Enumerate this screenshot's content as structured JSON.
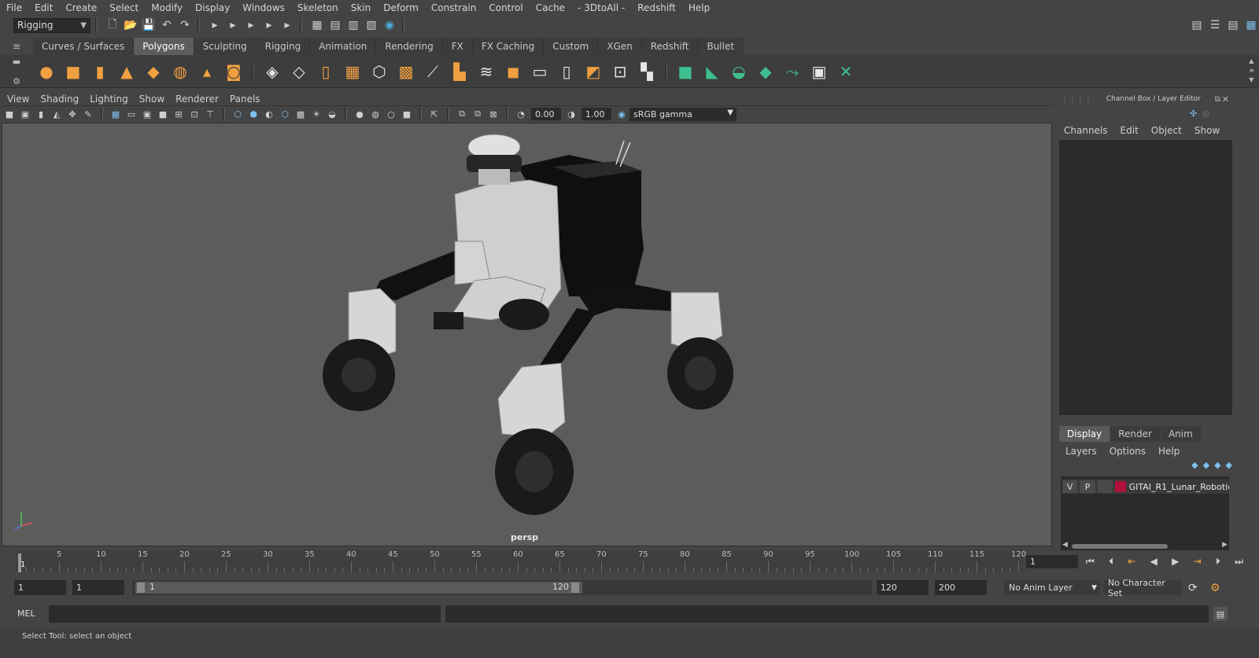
{
  "menubar": [
    "File",
    "Edit",
    "Create",
    "Select",
    "Modify",
    "Display",
    "Windows",
    "Skeleton",
    "Skin",
    "Deform",
    "Constrain",
    "Control",
    "Cache",
    "- 3DtoAll -",
    "Redshift",
    "Help"
  ],
  "statusline": {
    "mode": "Rigging"
  },
  "shelf_tabs": [
    "Curves / Surfaces",
    "Polygons",
    "Sculpting",
    "Rigging",
    "Animation",
    "Rendering",
    "FX",
    "FX Caching",
    "Custom",
    "XGen",
    "Redshift",
    "Bullet"
  ],
  "active_shelf_tab": "Polygons",
  "viewport": {
    "menu": [
      "View",
      "Shading",
      "Lighting",
      "Show",
      "Renderer",
      "Panels"
    ],
    "exposure": "0.00",
    "gamma_value": "1.00",
    "color_space": "sRGB gamma",
    "camera": "persp"
  },
  "channel_box": {
    "title": "Channel Box / Layer Editor",
    "menu": [
      "Channels",
      "Edit",
      "Object",
      "Show"
    ]
  },
  "layer_editor": {
    "tabs": [
      "Display",
      "Render",
      "Anim"
    ],
    "active_tab": "Display",
    "menu": [
      "Layers",
      "Options",
      "Help"
    ],
    "layers": [
      {
        "v": "V",
        "p": "P",
        "color": "#b0103a",
        "name": "GITAI_R1_Lunar_Robotic"
      }
    ]
  },
  "timeslider": {
    "ticks": [
      "5",
      "10",
      "15",
      "20",
      "25",
      "30",
      "35",
      "40",
      "45",
      "50",
      "55",
      "60",
      "65",
      "70",
      "75",
      "80",
      "85",
      "90",
      "95",
      "100",
      "105",
      "110",
      "115",
      "120"
    ],
    "current_frame": "1",
    "current_frame_field": "1"
  },
  "range": {
    "start": "1",
    "start_inner": "1",
    "range_start_label": "1",
    "range_end_label": "120",
    "end_inner": "120",
    "end": "200",
    "anim_layer": "No Anim Layer",
    "character_set": "No Character Set"
  },
  "command": {
    "lang": "MEL"
  },
  "helpline": "Select Tool: select an object"
}
